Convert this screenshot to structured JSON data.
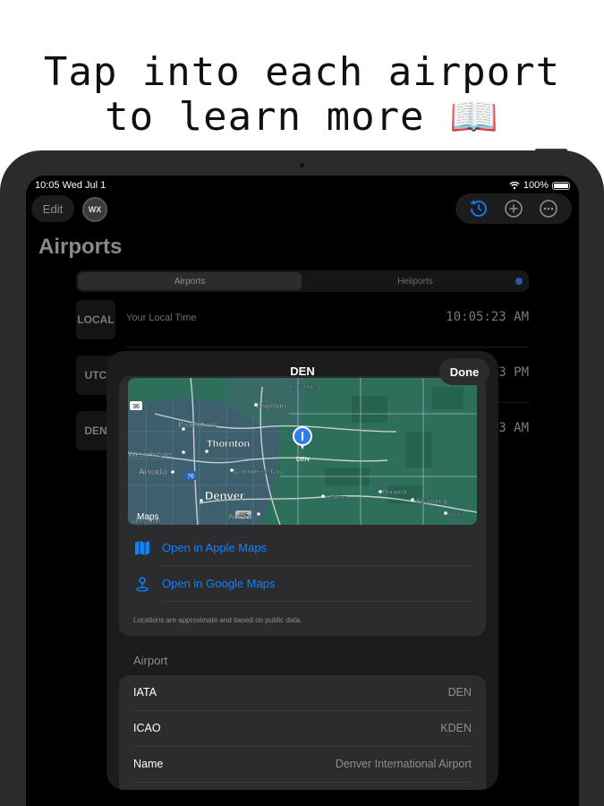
{
  "headline": {
    "line1": "Tap into each airport",
    "line2": "to learn more 📖"
  },
  "status_bar": {
    "time_date": "10:05  Wed Jul 1",
    "battery": "100%"
  },
  "nav": {
    "edit_label": "Edit",
    "avatar_text": "WX"
  },
  "page": {
    "title": "Airports"
  },
  "segment": {
    "items": [
      "Airports",
      "Heliports"
    ]
  },
  "timezones": [
    {
      "badge": "LOCAL",
      "label": "Your Local Time",
      "time": "10:05:23 AM"
    },
    {
      "badge": "UTC",
      "label": "",
      "time": "3 PM"
    },
    {
      "badge": "DEN",
      "label": "",
      "time": "3 AM"
    }
  ],
  "sheet": {
    "title": "DEN",
    "done_label": "Done",
    "map": {
      "pin_label": "DEN",
      "attribution": "Maps",
      "places": [
        "Brighton",
        "Broomfield",
        "Thornton",
        "Westminster",
        "Arvada",
        "Commerce City",
        "Denver",
        "Aurora",
        "Watkins",
        "Bennett",
        "Strasburg",
        "Byers",
        "Lochbuie",
        "Lakewood"
      ],
      "route_shields": [
        "36",
        "76",
        "225"
      ]
    },
    "links": [
      {
        "label": "Open in Apple Maps",
        "icon": "map-icon"
      },
      {
        "label": "Open in Google Maps",
        "icon": "location-pin-icon"
      }
    ],
    "footnote": "Locations are approximate and based on public data.",
    "section_title": "Airport",
    "fields": [
      {
        "key": "IATA",
        "value": "DEN"
      },
      {
        "key": "ICAO",
        "value": "KDEN"
      },
      {
        "key": "Name",
        "value": "Denver International Airport"
      }
    ]
  },
  "colors": {
    "accent": "#0a84ff",
    "map_green": "#2d6f5b",
    "sheet_bg": "#1c1c1e"
  }
}
